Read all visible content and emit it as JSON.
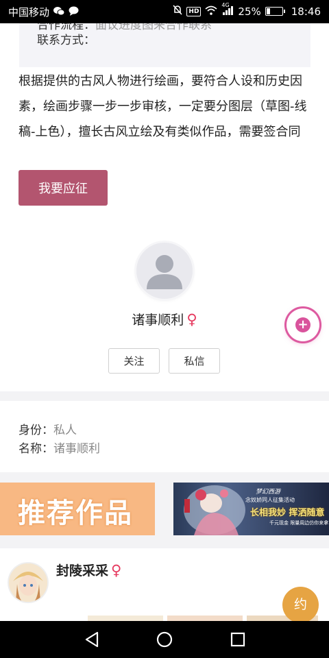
{
  "status_bar": {
    "carrier": "中国移动",
    "network": "4G",
    "hd": "HD",
    "battery": "25%",
    "battery_level": 0.25,
    "time": "18:46"
  },
  "detail": {
    "process_label": "合作流程：",
    "process_value": "面议进度图来合作联系",
    "contact_label": "联系方式：",
    "description": "根据提供的古风人物进行绘画，要符合人设和历史因素，绘画步骤一步一步审核，一定要分图层（草图-线稿-上色），擅长古风立绘及有类似作品，需要签合同",
    "apply_button": "我要应征"
  },
  "publisher": {
    "name": "诸事顺利",
    "gender_symbol": "♀",
    "follow_button": "关注",
    "message_button": "私信"
  },
  "floating_button": {
    "symbol": "+"
  },
  "identity": {
    "role_label": "身份：",
    "role_value": "私人",
    "name_label": "名称：",
    "name_value": "诸事顺利"
  },
  "banners": {
    "recommend": "推荐作品",
    "event_title": "梦幻西游",
    "event_subtitle": "念奴娇同人征集活动",
    "event_main": "长相我妙 挥洒随意",
    "event_tag": "千元现金 限量周边仿你来拿"
  },
  "recommended_user": {
    "name": "封陵采采",
    "gender_symbol": "♀",
    "book_button": "约"
  },
  "colors": {
    "apply_button": "#b3556f",
    "female": "#e63a5f",
    "float_ring": "#dd5aa0",
    "book_button": "#e6a443",
    "banner_left": "#f8b883"
  }
}
